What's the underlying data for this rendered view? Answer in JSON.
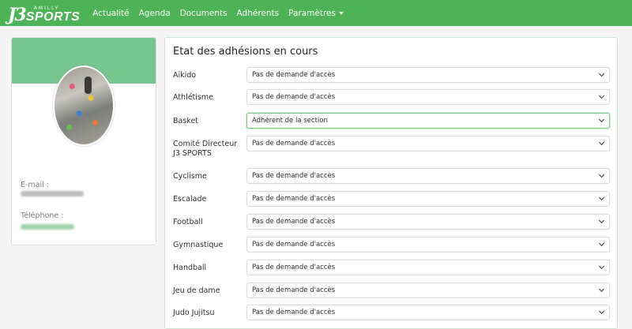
{
  "app": {
    "logo_mark": "J3",
    "logo_small": "AMILLY",
    "logo_big": "SPORTS"
  },
  "nav": {
    "items": [
      "Actualité",
      "Agenda",
      "Documents",
      "Adhérents"
    ],
    "menu_label": "Paramètres"
  },
  "profile": {
    "email_label": "E-mail :",
    "phone_label": "Téléphone :"
  },
  "memberships": {
    "title": "Etat des adhésions en cours",
    "rows": [
      {
        "section": "Aïkido",
        "status": "Pas de demande d'accès"
      },
      {
        "section": "Athlétisme",
        "status": "Pas de demande d'accès"
      },
      {
        "section": "Basket",
        "status": "Adhérent de la section"
      },
      {
        "section": "Comité Directeur J3 SPORTS",
        "status": "Pas de demande d'accès"
      },
      {
        "section": "Cyclisme",
        "status": "Pas de demande d'accès"
      },
      {
        "section": "Escalade",
        "status": "Pas de demande d'accès"
      },
      {
        "section": "Football",
        "status": "Pas de demande d'accès"
      },
      {
        "section": "Gymnastique",
        "status": "Pas de demande d'accès"
      },
      {
        "section": "Handball",
        "status": "Pas de demande d'accès"
      },
      {
        "section": "Jeu de dame",
        "status": "Pas de demande d'accès"
      },
      {
        "section": "Judo Jujitsu",
        "status": "Pas de demande d'accès"
      }
    ]
  },
  "colors": {
    "navbar": "#4db357",
    "banner": "#5fbc7b",
    "active_border": "#7cc98f"
  }
}
